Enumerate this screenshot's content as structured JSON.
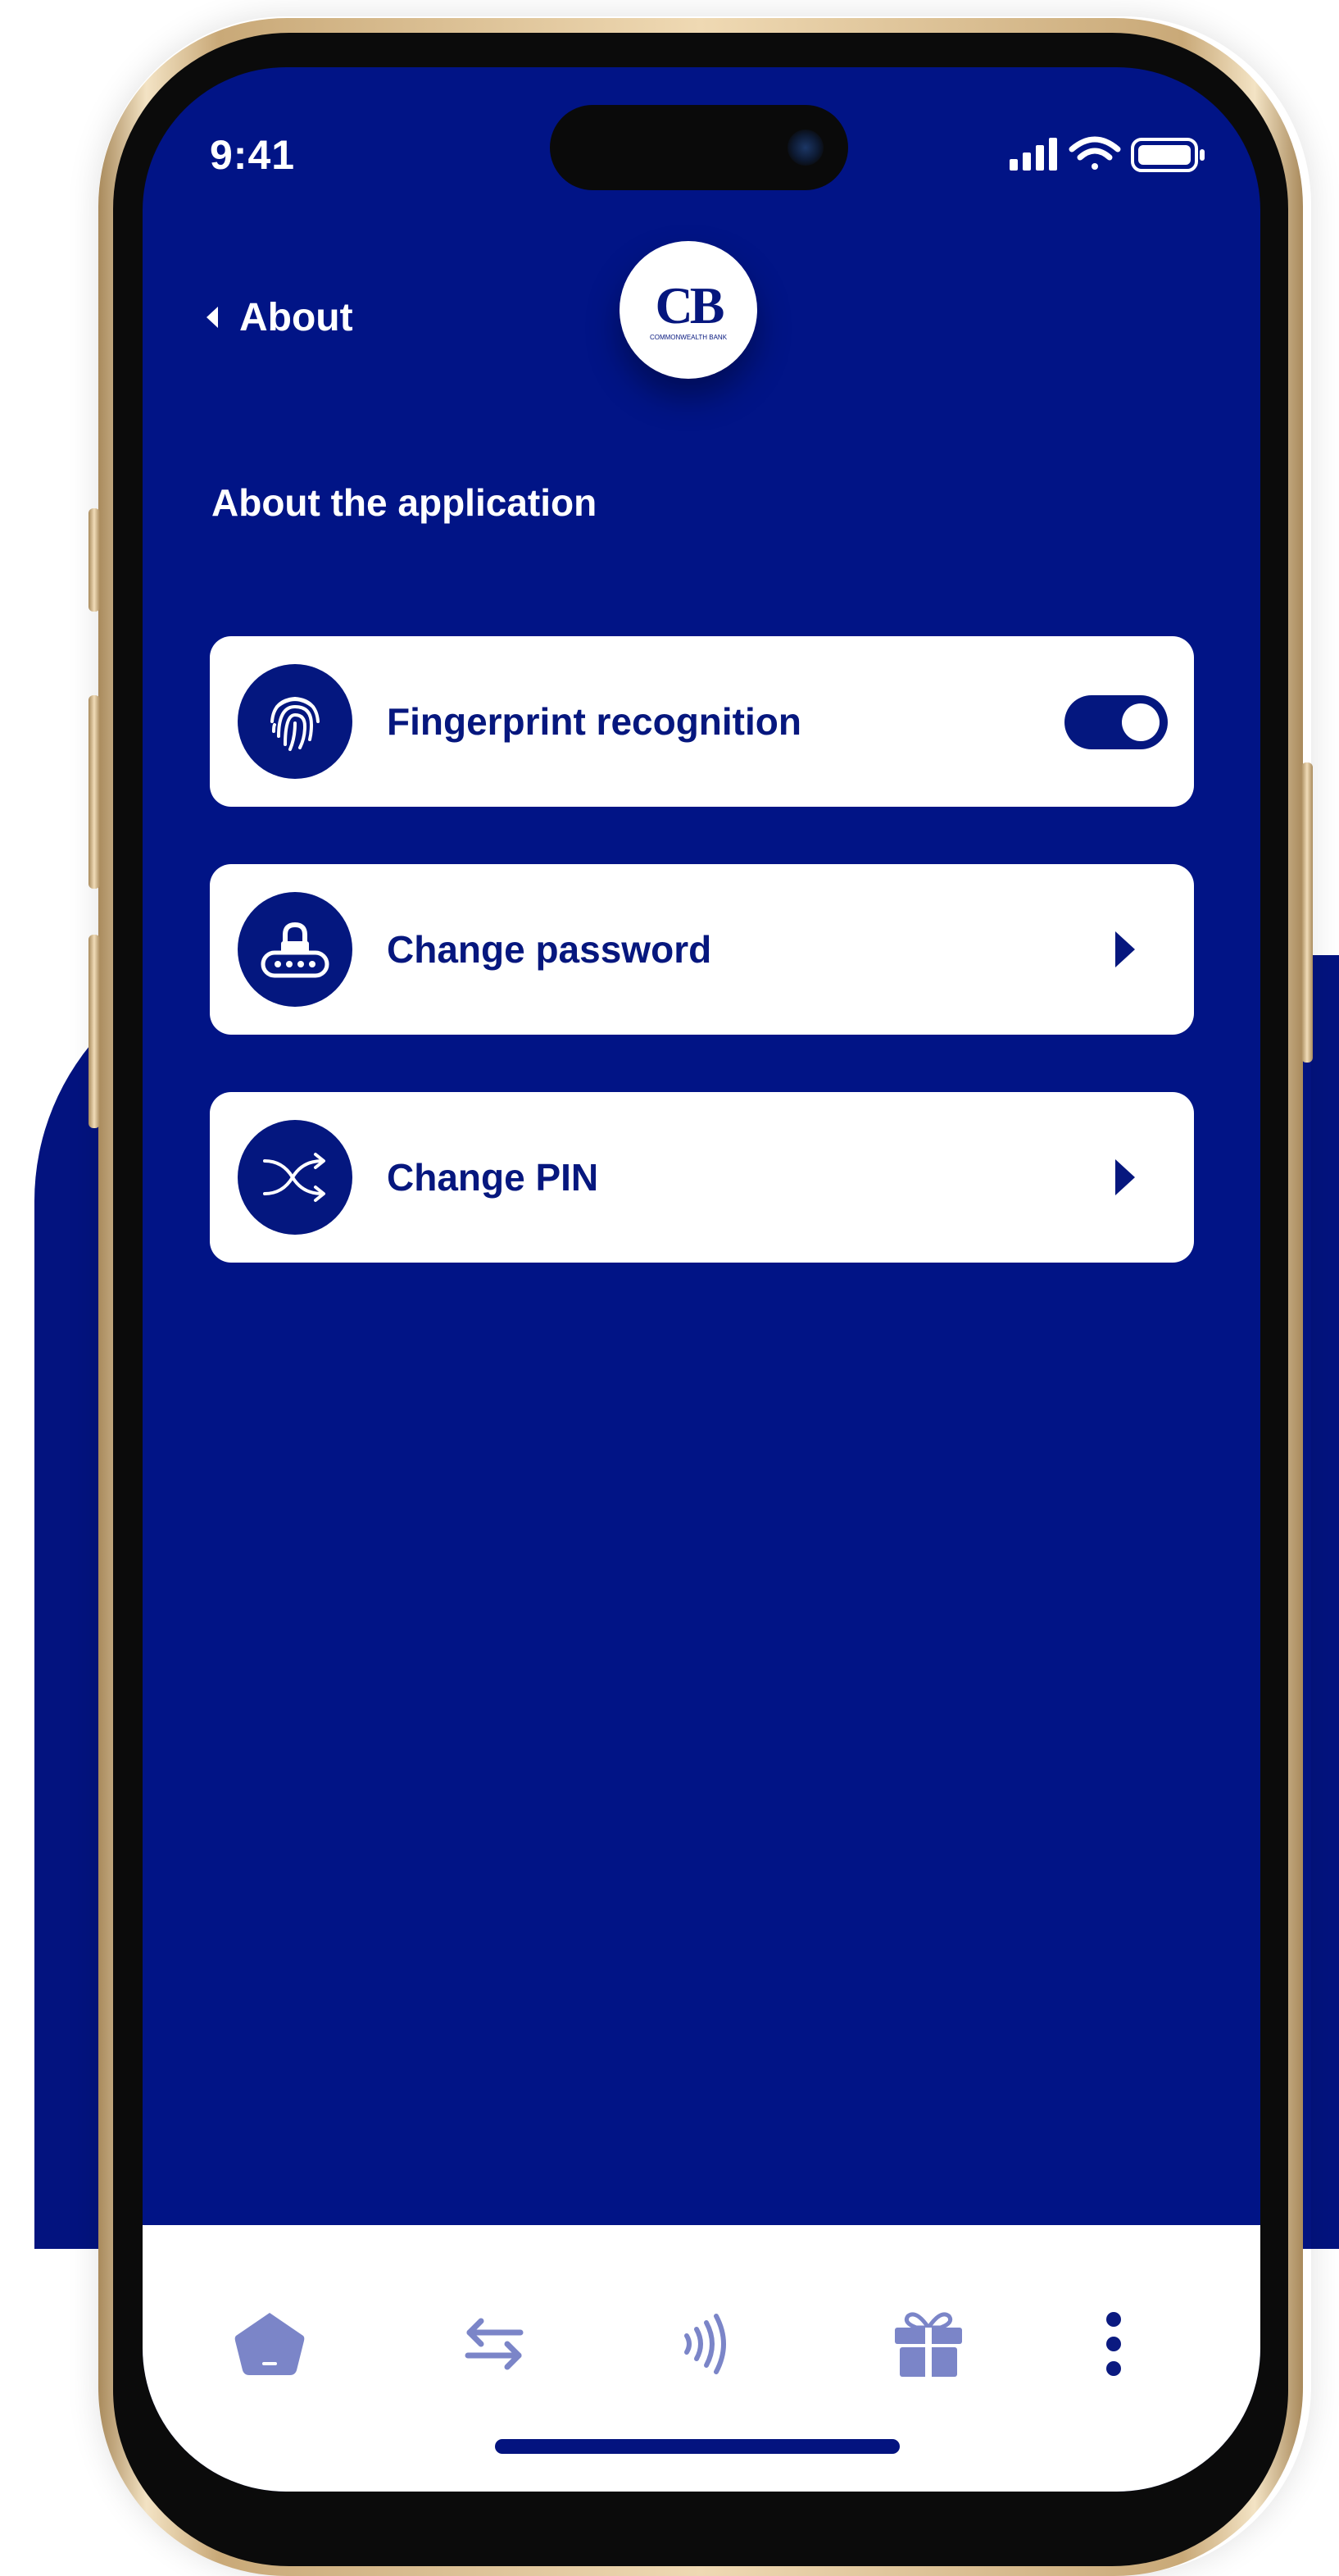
{
  "status_bar": {
    "time": "9:41"
  },
  "header": {
    "back_label": "About",
    "logo": {
      "monogram": "CB",
      "caption": "COMMONWEALTH BANK"
    }
  },
  "section_title": "About the application",
  "settings": [
    {
      "label": "Fingerprint recognition",
      "icon": "fingerprint-icon",
      "control": "toggle",
      "enabled": true
    },
    {
      "label": "Change password",
      "icon": "padlock-password-icon",
      "control": "chevron"
    },
    {
      "label": "Change PIN",
      "icon": "shuffle-icon",
      "control": "chevron"
    }
  ],
  "tab_bar": {
    "items": [
      {
        "icon": "home-icon"
      },
      {
        "icon": "transfer-arrows-icon"
      },
      {
        "icon": "contactless-icon"
      },
      {
        "icon": "gift-icon"
      },
      {
        "icon": "more-dots-icon"
      }
    ]
  },
  "colors": {
    "primary": "#011486",
    "card": "#ffffff",
    "card_text": "#06177e",
    "tab_icon": "#7b85c8"
  }
}
